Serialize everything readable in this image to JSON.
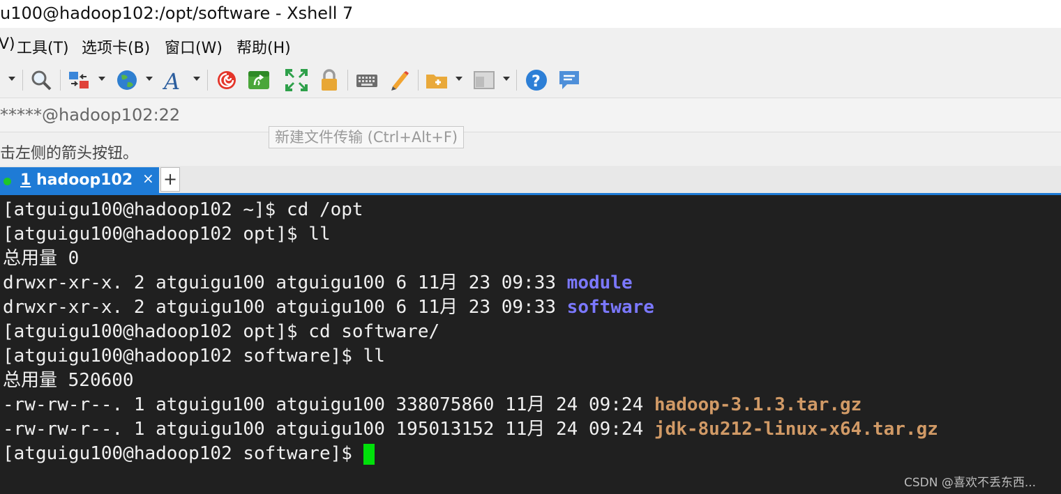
{
  "window": {
    "title": "u100@hadoop102:/opt/software - Xshell 7"
  },
  "menu": [
    {
      "label": "V)"
    },
    {
      "label": "工具(T)"
    },
    {
      "label": "选项卡(B)"
    },
    {
      "label": "窗口(W)"
    },
    {
      "label": "帮助(H)"
    }
  ],
  "toolbar": {
    "icons": [
      "arrow-dropdown-icon",
      "find-icon",
      "transfer-icon",
      "globe-icon",
      "font-icon",
      "xftp-swirl-icon",
      "new-file-transfer-icon",
      "fullscreen-icon",
      "lock-icon",
      "keyboard-icon",
      "highlight-pen-icon",
      "new-folder-icon",
      "layout-icon",
      "help-icon",
      "chat-icon"
    ],
    "tooltip": "新建文件传输 (Ctrl+Alt+F)"
  },
  "address": {
    "text": "*****@hadoop102:22"
  },
  "hint": {
    "text": "击左侧的箭头按钮。"
  },
  "tabs": [
    {
      "number": "1",
      "label": " hadoop102",
      "close": "×",
      "status_color": "#1ec62a"
    }
  ],
  "tab_add": "+",
  "terminal": {
    "lines": [
      {
        "text": "[atguigu100@hadoop102 ~]$ cd /opt"
      },
      {
        "text": "[atguigu100@hadoop102 opt]$ ll"
      },
      {
        "text": "总用量 0"
      },
      {
        "prefix": "drwxr-xr-x. 2 atguigu100 atguigu100 6 11月 23 09:33 ",
        "name": "module"
      },
      {
        "prefix": "drwxr-xr-x. 2 atguigu100 atguigu100 6 11月 23 09:33 ",
        "name": "software"
      },
      {
        "text": "[atguigu100@hadoop102 opt]$ cd software/"
      },
      {
        "text": "[atguigu100@hadoop102 software]$ ll"
      },
      {
        "text": "总用量 520600"
      },
      {
        "prefix": "-rw-rw-r--. 1 atguigu100 atguigu100 338075860 11月 24 09:24 ",
        "name": "hadoop-3.1.3.tar.gz"
      },
      {
        "prefix": "-rw-rw-r--. 1 atguigu100 atguigu100 195013152 11月 24 09:24 ",
        "name": "jdk-8u212-linux-x64.tar.gz"
      },
      {
        "text": "[atguigu100@hadoop102 software]$ "
      }
    ]
  },
  "watermark": "CSDN @喜欢不丢东西...",
  "colors": {
    "accent": "#1e7bd6",
    "directory": "#7b78ff",
    "archive": "#d19a66",
    "cursor": "#00e00a",
    "highlight": "#e8202a"
  }
}
